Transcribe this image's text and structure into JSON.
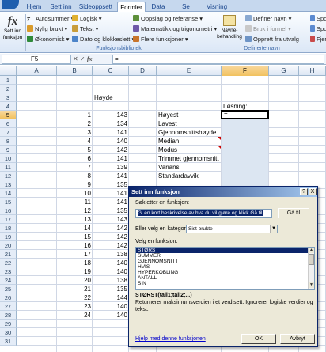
{
  "ribbon": {
    "tabs": [
      "Hjem",
      "Sett inn",
      "Sideoppsett",
      "Formler",
      "Data",
      "Se gjennom",
      "Visning"
    ],
    "active_tab": "Formler",
    "insert_function": "Sett inn funksjon",
    "library": [
      "Autosummer ▾",
      "Nylig brukt ▾",
      "Økonomisk ▾",
      "Logisk ▾",
      "Tekst ▾",
      "Dato og klokkeslett ▾",
      "Oppslag og referanse ▾",
      "Matematikk og trigonometri ▾",
      "Flere funksjoner ▾"
    ],
    "names_manager": "Navne-behandling",
    "names_items": [
      "Definer navn ▾",
      "Bruk i formel ▾",
      "Opprett fra utvalg"
    ],
    "audit_items": [
      "Spo",
      "Spo",
      "Fjer"
    ],
    "group_library": "Funksjonsbibliotek",
    "group_names": "Definerte navn"
  },
  "formula_bar": {
    "cell_ref": "F5",
    "buttons": "✕ ✓",
    "fx": "fx",
    "value": "="
  },
  "sheet": {
    "columns": [
      "A",
      "B",
      "C",
      "D",
      "E",
      "F",
      "G",
      "H"
    ],
    "selected_column": "F",
    "selected_row": "5",
    "rows": [
      "1",
      "2",
      "3",
      "4",
      "5",
      "6",
      "7",
      "8",
      "9",
      "10",
      "11",
      "12",
      "13",
      "14",
      "15",
      "16",
      "17",
      "18",
      "19",
      "20",
      "21",
      "22",
      "23",
      "24",
      "25",
      "26",
      "27",
      "28",
      "29",
      "30",
      "31"
    ],
    "header_c": "Høyde",
    "solution_label": "Løsning:",
    "f5_value": "=",
    "index": [
      1,
      2,
      3,
      4,
      5,
      6,
      7,
      8,
      9,
      10,
      11,
      12,
      13,
      14,
      15,
      16,
      17,
      18,
      19,
      20,
      21,
      22,
      23,
      24
    ],
    "heights": [
      143,
      134,
      141,
      140,
      142,
      141,
      139,
      141,
      135,
      141,
      141,
      135,
      143,
      142,
      142,
      142,
      138,
      140,
      140,
      138,
      135,
      144,
      140,
      140
    ],
    "stats_labels": [
      "Høyest",
      "Lavest",
      "Gjennomsnittshøyde",
      "Median",
      "Modus",
      "Trimmet gjennomsnitt",
      "Varians",
      "Standardavvik"
    ]
  },
  "dialog": {
    "title": "Sett inn funksjon",
    "help_btn": "?",
    "close_btn": "X",
    "search_label": "Søk etter en funksjon:",
    "search_text": "Gi en kort beskrivelse av hva du vil gjøre og klikk Gå til",
    "go_button": "Gå til",
    "category_label": "Eller velg en kategori:",
    "category_value": "Sist brukte",
    "function_label": "Velg en funksjon:",
    "functions": [
      "STØRST",
      "SUMMER",
      "GJENNOMSNITT",
      "HVIS",
      "HYPERKOBLING",
      "ANTALL",
      "SIN"
    ],
    "selected_function": "STØRST",
    "syntax": "STØRST(tall1;tall2;...)",
    "description": "Returnerer maksimumsverdien i et verdisett. Ignorerer logiske verdier og tekst.",
    "help_link": "Hjelp med denne funksjonen",
    "ok": "OK",
    "cancel": "Avbryt"
  }
}
